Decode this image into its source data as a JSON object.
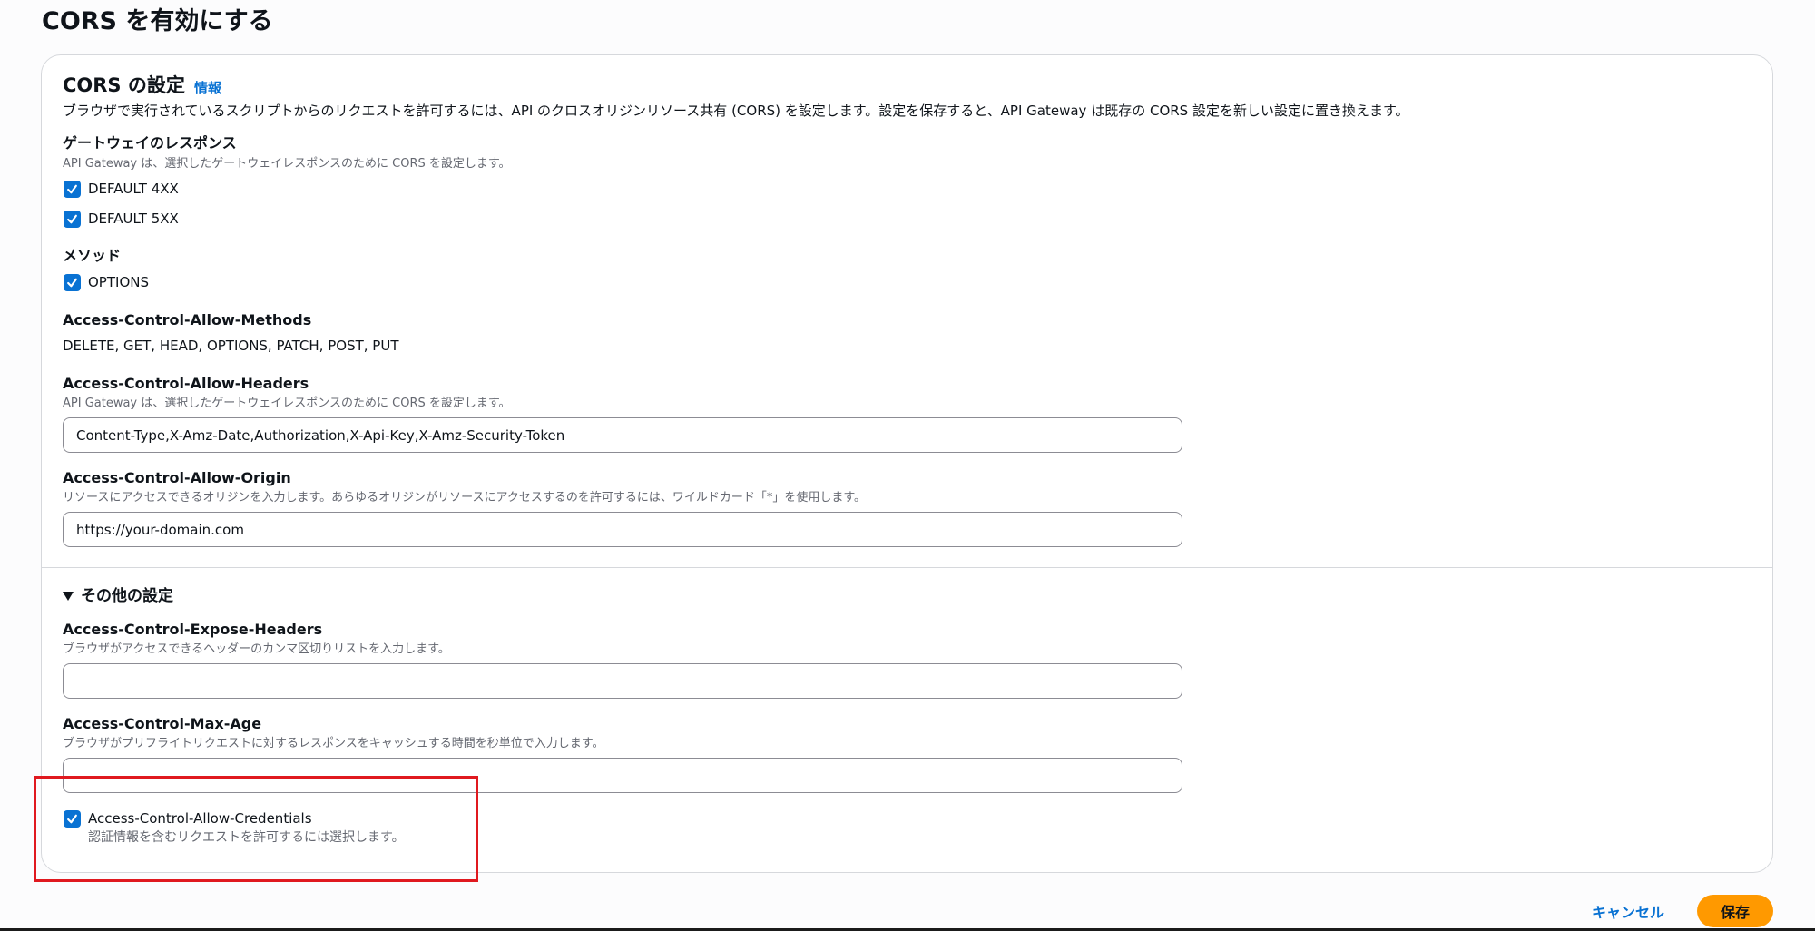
{
  "page": {
    "title": "CORS を有効にする"
  },
  "cors": {
    "title": "CORS の設定",
    "info_link": "情報",
    "description": "ブラウザで実行されているスクリプトからのリクエストを許可するには、API のクロスオリジンリソース共有 (CORS) を設定します。設定を保存すると、API Gateway は既存の CORS 設定を新しい設定に置き換えます。",
    "gateway_responses": {
      "label": "ゲートウェイのレスポンス",
      "hint": "API Gateway は、選択したゲートウェイレスポンスのために CORS を設定します。",
      "options": [
        {
          "label": "DEFAULT 4XX",
          "checked": true
        },
        {
          "label": "DEFAULT 5XX",
          "checked": true
        }
      ]
    },
    "methods": {
      "label": "メソッド",
      "options": [
        {
          "label": "OPTIONS",
          "checked": true
        }
      ]
    },
    "allow_methods": {
      "label": "Access-Control-Allow-Methods",
      "value": "DELETE, GET, HEAD, OPTIONS, PATCH, POST, PUT"
    },
    "allow_headers": {
      "label": "Access-Control-Allow-Headers",
      "hint": "API Gateway は、選択したゲートウェイレスポンスのために CORS を設定します。",
      "value": "Content-Type,X-Amz-Date,Authorization,X-Api-Key,X-Amz-Security-Token"
    },
    "allow_origin": {
      "label": "Access-Control-Allow-Origin",
      "hint": "リソースにアクセスできるオリジンを入力します。あらゆるオリジンがリソースにアクセスするのを許可するには、ワイルドカード「*」を使用します。",
      "value": "https://your-domain.com"
    },
    "other_settings": {
      "label": "その他の設定",
      "expanded": true,
      "expose_headers": {
        "label": "Access-Control-Expose-Headers",
        "hint": "ブラウザがアクセスできるヘッダーのカンマ区切りリストを入力します。",
        "value": ""
      },
      "max_age": {
        "label": "Access-Control-Max-Age",
        "hint": "ブラウザがプリフライトリクエストに対するレスポンスをキャッシュする時間を秒単位で入力します。",
        "value": ""
      },
      "allow_credentials": {
        "label": "Access-Control-Allow-Credentials",
        "hint": "認証情報を含むリクエストを許可するには選択します。",
        "checked": true
      }
    }
  },
  "footer": {
    "cancel_label": "キャンセル",
    "save_label": "保存"
  },
  "colors": {
    "accent": "#0972d3",
    "primary_button": "#ff9900",
    "highlight": "#e0191f"
  }
}
